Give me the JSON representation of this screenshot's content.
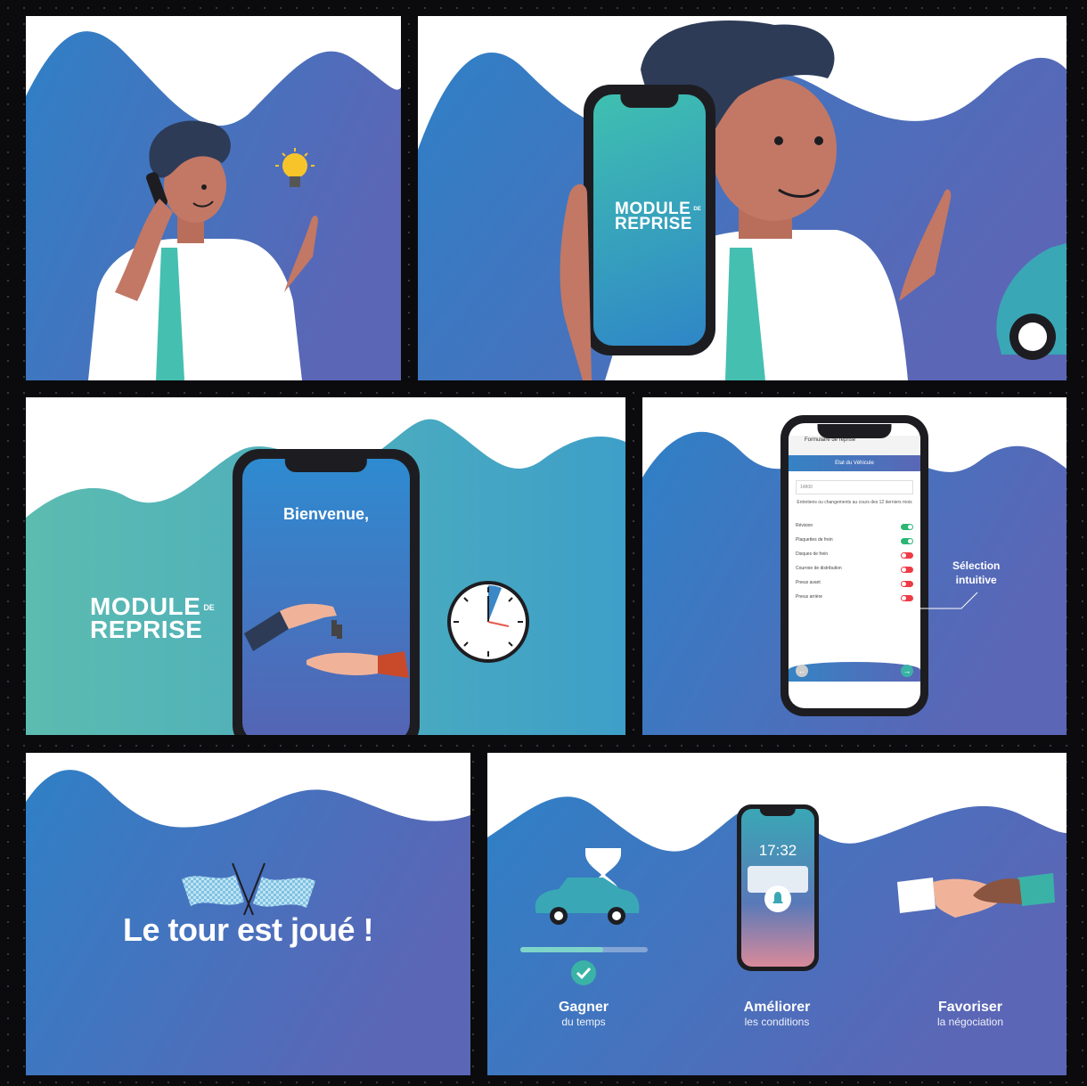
{
  "panel_logo": {
    "line1": "MODULE",
    "small": "DE",
    "line2": "REPRISE"
  },
  "welcome_phone": {
    "greeting": "Bienvenue,"
  },
  "form_phone": {
    "browser_title": "Formulaire de reprise",
    "section_title": "Etat du Véhicule",
    "field_value": "14800",
    "question": "Entretiens ou changements au cours des 12 derniers mois",
    "items": [
      {
        "label": "Révision",
        "on": true
      },
      {
        "label": "Plaquettes de frein",
        "on": true
      },
      {
        "label": "Disques de frein",
        "on": false
      },
      {
        "label": "Courroie de distribution",
        "on": false
      },
      {
        "label": "Pneus avant",
        "on": false
      },
      {
        "label": "Pneus arrière",
        "on": false
      }
    ]
  },
  "callout": {
    "line1": "Sélection",
    "line2": "intuitive"
  },
  "finish": {
    "headline": "Le tour est joué !"
  },
  "lock_screen": {
    "time": "17:32"
  },
  "benefits": [
    {
      "title": "Gagner",
      "subtitle": "du temps"
    },
    {
      "title": "Améliorer",
      "subtitle": "les conditions"
    },
    {
      "title": "Favoriser",
      "subtitle": "la négociation"
    }
  ],
  "colors": {
    "blue": "#3583c4",
    "violet": "#5a67b6",
    "teal": "#45a9b4",
    "accent_teal": "#3ab3a6"
  }
}
